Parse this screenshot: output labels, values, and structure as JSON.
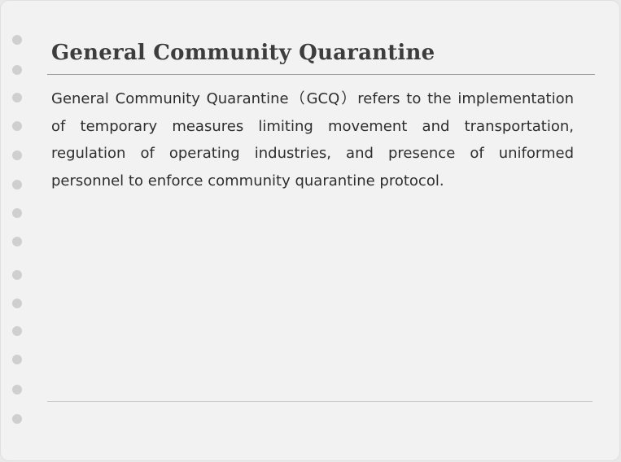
{
  "note": {
    "title": "General Community Quarantine",
    "body": "General Community Quarantine（GCQ）refers to the implementation of temporary measures limiting movement and transportation, regulation of operating industries, and presence of uniformed personnel to enforce community quarantine protocol."
  },
  "colors": {
    "page_background": "#f2f2f2",
    "hole": "#cfcfcf",
    "title_text": "#3d3d3d",
    "body_text": "#2e2e2e"
  }
}
